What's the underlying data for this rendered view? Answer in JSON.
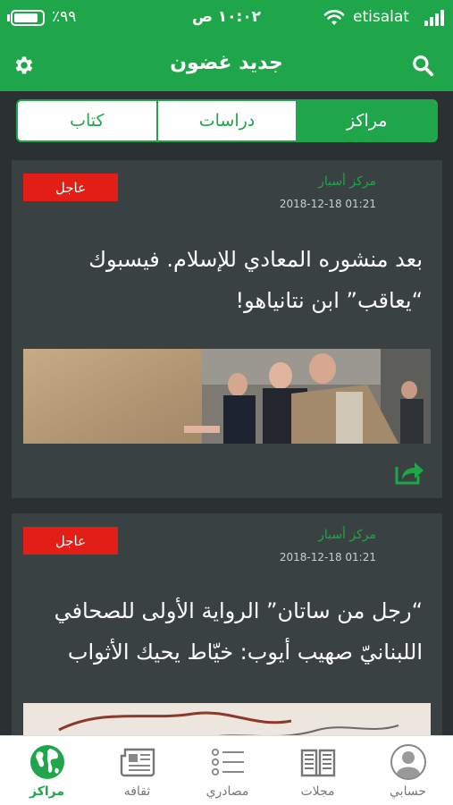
{
  "status_bar": {
    "battery_percent": "٪٩٩",
    "time": "١٠:٠٢ ص",
    "carrier": "etisalat"
  },
  "header": {
    "title": "جديد غضون"
  },
  "segments": [
    {
      "label": "مراكز",
      "active": true
    },
    {
      "label": "دراسات",
      "active": false
    },
    {
      "label": "كتاب",
      "active": false
    }
  ],
  "cards": [
    {
      "badge": "عاجل",
      "source": "مركز أسبار",
      "time": "2018-12-18 01:21",
      "headline_line1": "بعد منشوره المعادي للإسلام. فيسبوك",
      "headline_line2": "“يعاقب” ابن نتانياهو!"
    },
    {
      "badge": "عاجل",
      "source": "مركز أسبار",
      "time": "2018-12-18 01:21",
      "headline_line1": "“رجل من ساتان” الرواية الأولى للصحافي",
      "headline_line2": "اللبنانيّ صهيب أيوب: خيّاط يحيك الأثواب"
    }
  ],
  "tabs": [
    {
      "label": "حسابي",
      "icon": "profile-icon"
    },
    {
      "label": "مجلات",
      "icon": "book-icon"
    },
    {
      "label": "مصادري",
      "icon": "list-icon"
    },
    {
      "label": "ثقافه",
      "icon": "newspaper-icon"
    },
    {
      "label": "مراكز",
      "icon": "globe-icon",
      "active": true
    }
  ],
  "colors": {
    "brand_green": "#1fa64a",
    "badge_red": "#e31e17",
    "background": "#2b3133",
    "card": "#3a4143"
  }
}
